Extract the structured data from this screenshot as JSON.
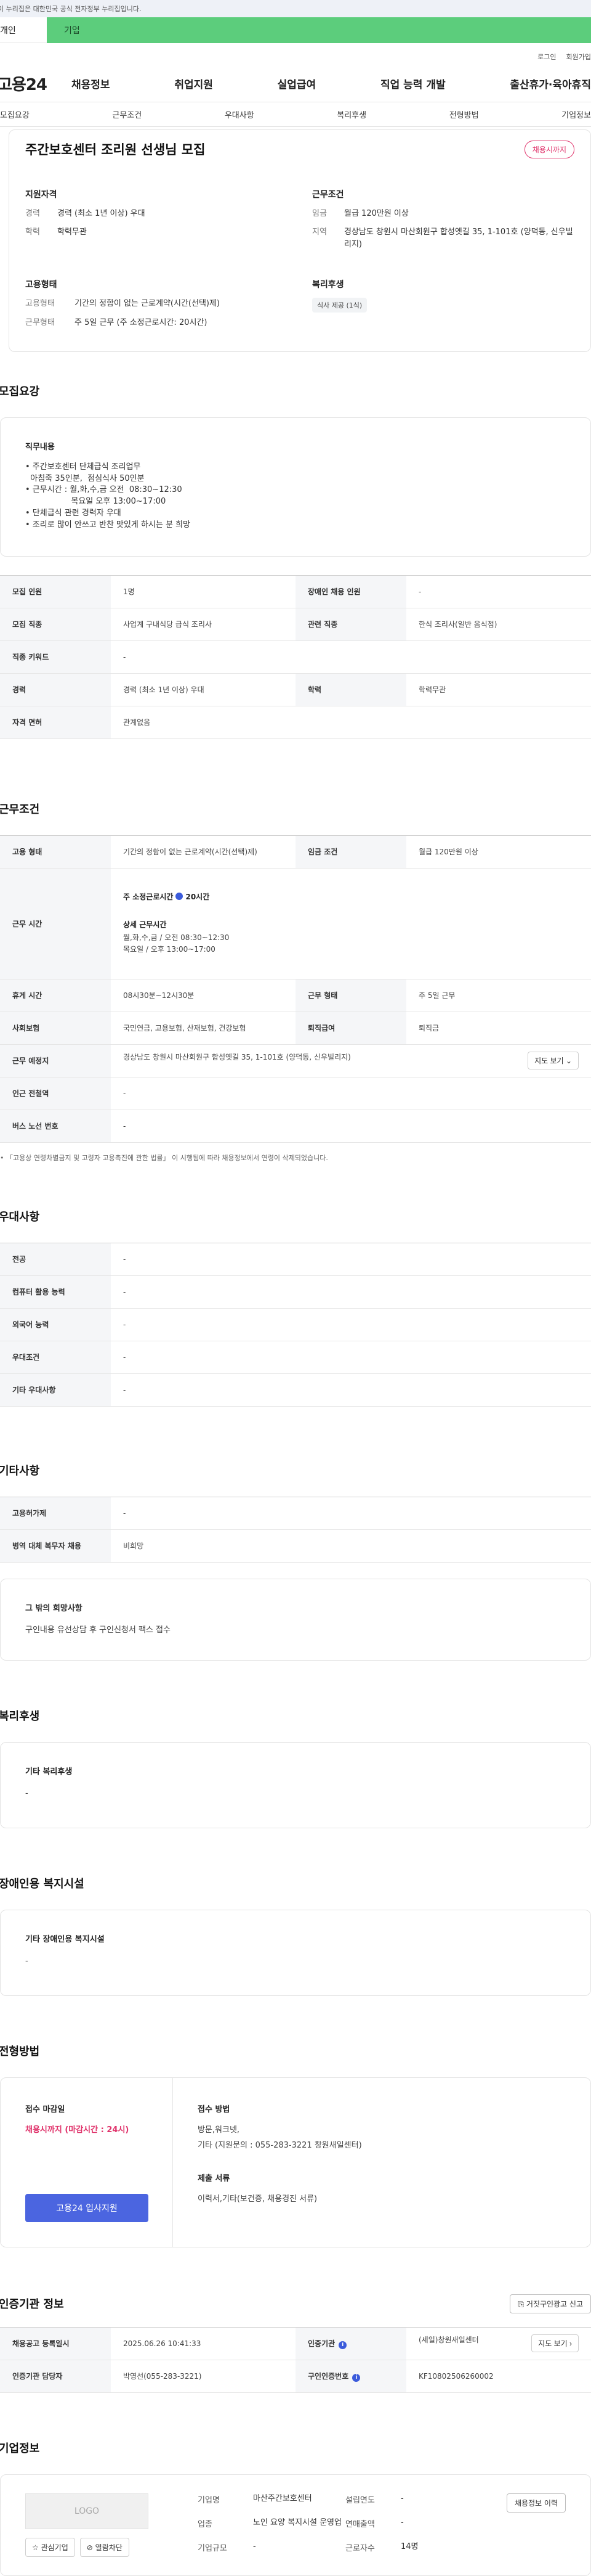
{
  "gov_banner": "이 누리집은 대한민국 공식 전자정부 누리집입니다.",
  "user_tabs": {
    "personal": "개인",
    "company": "기업"
  },
  "util_links": [
    "로그인",
    "회원가입"
  ],
  "logo": "고용24",
  "gnb": [
    "채용정보",
    "취업지원",
    "실업급여",
    "직업 능력 개발",
    "출산휴가·육아휴직"
  ],
  "anchor_tabs": [
    "모집요강",
    "근무조건",
    "우대사항",
    "복리후생",
    "전형방법",
    "기업정보"
  ],
  "summary": {
    "title": "주간보호센터 조리원 선생님 모집",
    "deadline_badge": "채용시까지",
    "qualification": {
      "heading": "지원자격",
      "career_k": "경력",
      "career_v": "경력 (최소 1년 이상) 우대",
      "edu_k": "학력",
      "edu_v": "학력무관"
    },
    "conditions": {
      "heading": "근무조건",
      "wage_k": "임금",
      "wage_v": "월급 120만원 이상",
      "region_k": "지역",
      "region_v": "경상남도 창원시 마산회원구 합성옛길 35, 1-101호 (양덕동, 신우빌리지)"
    },
    "employment": {
      "heading": "고용형태",
      "type_k": "고용형태",
      "type_v": "기간의 정함이 없는 근로계약(시간(선택)제)",
      "form_k": "근무형태",
      "form_v": "주 5일 근무 (주 소정근로시간: 20시간)"
    },
    "welfare": {
      "heading": "복리후생",
      "chip": "식사 제공 (1식)"
    }
  },
  "recruit": {
    "title": "모집요강",
    "duty_heading": "직무내용",
    "duty_lines": [
      "• 주간보호센터 단체급식 조리업무",
      "  아침죽 35인분,  점심식사 50인분",
      "• 근무시간 : 월,화,수,금 오전  08:30~12:30",
      "                  목요일 오후 13:00~17:00",
      "• 단체급식 관련 경력자 우대",
      "• 조리로 많이 안쓰고 반찬 맛있게 하시는 분 희망"
    ],
    "table": {
      "row1": {
        "h1": "모집 인원",
        "v1": "1명",
        "h2": "장애인 채용 인원",
        "v2": "-"
      },
      "row2": {
        "h1": "모집 직종",
        "v1": "사업계 구내식당 급식 조리사",
        "h2": "관련 직종",
        "v2": "한식 조리사(일반 음식점)"
      },
      "row3": {
        "h1": "직종 키워드",
        "v1": "-"
      },
      "row4": {
        "h1": "경력",
        "v1": "경력 (최소 1년 이상) 우대",
        "h2": "학력",
        "v2": "학력무관"
      },
      "row5": {
        "h1": "자격 면허",
        "v1": "관계없음"
      }
    }
  },
  "work": {
    "title": "근무조건",
    "emp_type_h": "고용 형태",
    "emp_type_v": "기간의 정함이 없는 근로계약(시간(선택)제)",
    "wage_h": "임금 조건",
    "wage_v": "월급 120만원 이상",
    "hours_h": "근무 시간",
    "hours_week_label": "주 소정근로시간",
    "hours_week_value": "20시간",
    "hours_detail_title": "상세 근무시간",
    "hours_detail_1": "월,화,수,금 / 오전  08:30~12:30",
    "hours_detail_2": "목요일 / 오후 13:00~17:00",
    "break_h": "휴게 시간",
    "break_v": "08시30분~12시30분",
    "form_h": "근무 형태",
    "form_v": "주 5일 근무",
    "insurance_h": "사회보험",
    "insurance_v": "국민연금, 고용보험, 산재보험, 건강보험",
    "retire_h": "퇴직급여",
    "retire_v": "퇴직금",
    "place_h": "근무 예정지",
    "place_v": "경상남도 창원시 마산회원구 합성옛길 35, 1-101호 (양덕동, 신우빌리지)",
    "map_btn": "지도 보기",
    "subway_h": "인근 전철역",
    "subway_v": "-",
    "bus_h": "버스 노선 번호",
    "bus_v": "-",
    "note": "• 「고용상 연령차별금지 및 고령자 고용촉진에 관한 법률」 이 시행됨에 따라 채용정보에서 연령이 삭제되었습니다."
  },
  "preference": {
    "title": "우대사항",
    "rows": [
      {
        "h": "전공",
        "v": "-"
      },
      {
        "h": "컴퓨터 활용 능력",
        "v": "-"
      },
      {
        "h": "외국어 능력",
        "v": "-"
      },
      {
        "h": "우대조건",
        "v": "-"
      },
      {
        "h": "기타 우대사항",
        "v": "-"
      }
    ]
  },
  "etc": {
    "title": "기타사항",
    "rows": [
      {
        "h": "고용허가제",
        "v": "-"
      },
      {
        "h": "병역 대체 복무자 채용",
        "v": "비희망"
      }
    ],
    "hope_heading": "그 밖의 희망사항",
    "hope_text": "구인내용 유선상담 후 구인신청서 팩스 접수"
  },
  "welfare": {
    "title": "복리후생",
    "heading": "기타 복리후생",
    "value": "-"
  },
  "disability": {
    "title": "장애인용 복지시설",
    "heading": "기타 장애인용 복지시설",
    "value": "-"
  },
  "process": {
    "title": "전형방법",
    "deadline_label": "접수 마감일",
    "deadline_value": "채용시까지 (마감시간 : 24시)",
    "apply_btn": "고용24 입사지원",
    "method_label": "접수 방법",
    "method_line1": "방문,워크넷,",
    "method_line2": "기타 (지원문의 : 055-283-3221 창원새일센터)",
    "docs_label": "제출 서류",
    "docs_value": "이력서,기타(보건증, 채용경진 서류)"
  },
  "agency": {
    "title": "인증기관 정보",
    "false_report_btn": "거짓구인광고 신고",
    "reg_h": "채용공고 등록일시",
    "reg_v": "2025.06.26 10:41:33",
    "org_h": "인증기관",
    "org_v": "(세일)창원새일센터",
    "map_btn": "지도 보기",
    "mgr_h": "인증기관 담당자",
    "mgr_v": "박영선(055-283-3221)",
    "cert_h": "구인인증번호",
    "cert_v": "KF10802506260002"
  },
  "company": {
    "title": "기업정보",
    "logo_text": "LOGO",
    "fav_btn": "관심기업",
    "block_btn": "열람차단",
    "history_btn": "채용정보 이력",
    "name_k": "기업명",
    "name_v": "마산주간보호센터",
    "year_k": "설립연도",
    "year_v": "-",
    "industry_k": "업종",
    "industry_v": "노인 요양 복지시설 운영업",
    "sales_k": "연매출액",
    "sales_v": "-",
    "employees_k": "근로자수",
    "employees_v": "14명",
    "size_k": "기업규모",
    "size_v": "-"
  }
}
